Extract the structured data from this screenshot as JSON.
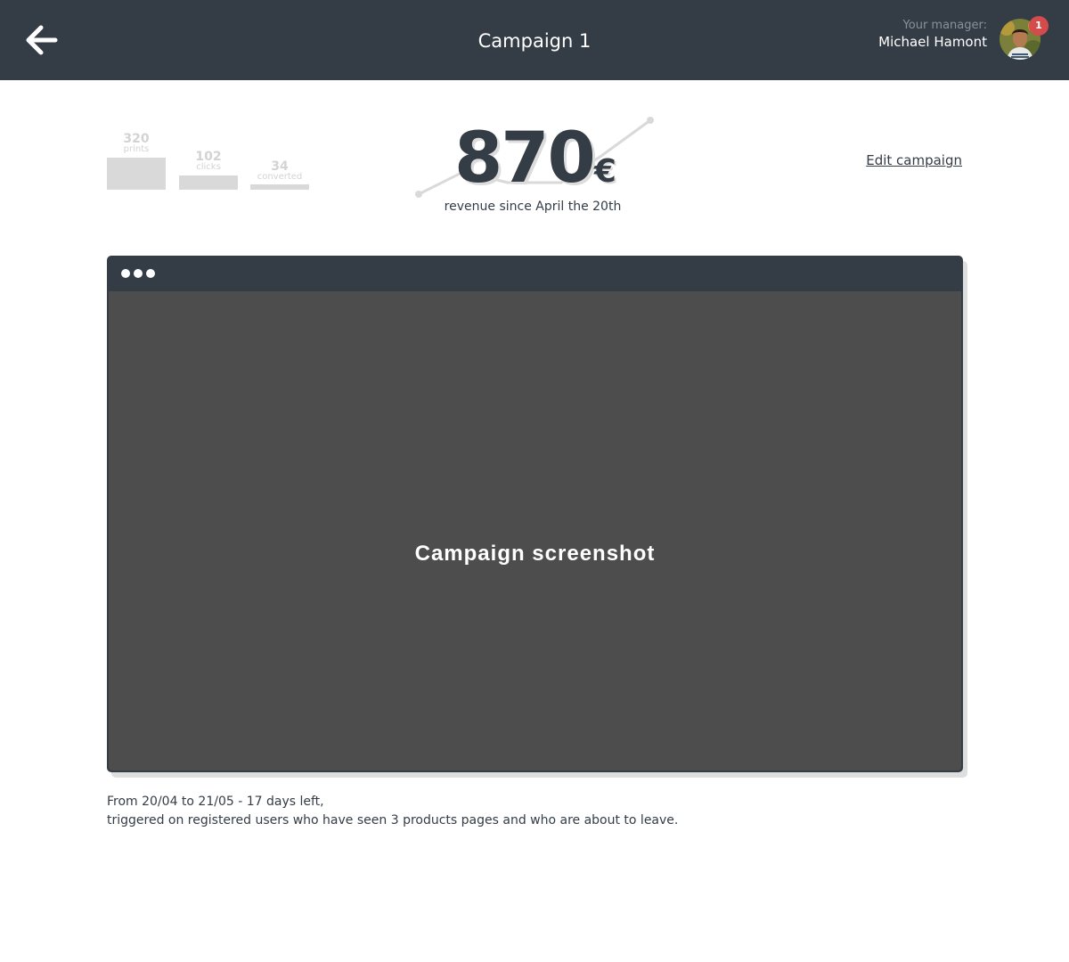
{
  "header": {
    "title": "Campaign 1",
    "back_icon": "arrow-left-icon",
    "manager_label": "Your manager:",
    "manager_name": "Michael Hamont",
    "notification_count": "1",
    "colors": {
      "background": "#343c46",
      "badge": "#d44b4b"
    }
  },
  "stats": {
    "funnel": [
      {
        "value": "320",
        "label": "prints"
      },
      {
        "value": "102",
        "label": "clicks"
      },
      {
        "value": "34",
        "label": "converted"
      }
    ],
    "revenue": {
      "value": "870",
      "currency": "€",
      "caption": "revenue since April the 20th"
    },
    "edit_label": "Edit campaign"
  },
  "preview": {
    "label": "Campaign screenshot",
    "window_icon": "window-dots-icon"
  },
  "description": {
    "line1": "From 20/04 to 21/05 - 17 days left,",
    "line2": "triggered on registered users who have seen 3 products pages and who are about to leave."
  }
}
